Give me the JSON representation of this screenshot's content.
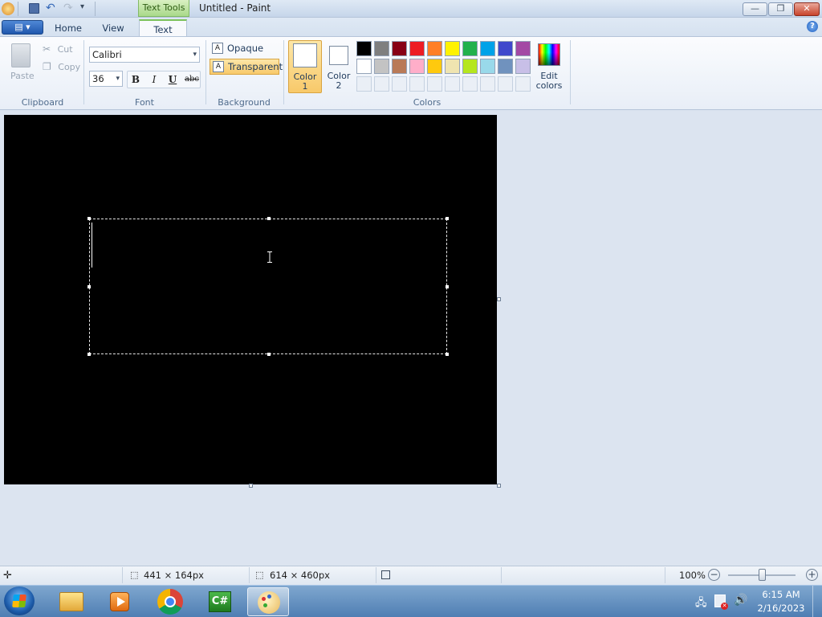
{
  "window": {
    "title": "Untitled - Paint",
    "context_tab": "Text Tools",
    "minimize": "—",
    "restore": "❐",
    "close": "✕"
  },
  "tabs": [
    {
      "label": "Home",
      "active": false
    },
    {
      "label": "View",
      "active": false
    },
    {
      "label": "Text",
      "active": true
    }
  ],
  "app_menu_label": "▤ ▾",
  "help": "?",
  "clipboard": {
    "group": "Clipboard",
    "paste": "Paste",
    "cut": "Cut",
    "copy": "Copy"
  },
  "font": {
    "group": "Font",
    "family": "Calibri",
    "size": "36",
    "bold": "B",
    "italic": "I",
    "underline": "U",
    "strike": "abc"
  },
  "background": {
    "group": "Background",
    "opaque": "Opaque",
    "transparent": "Transparent",
    "icon": "A"
  },
  "colors": {
    "group": "Colors",
    "color1": "Color 1",
    "color1_line1": "Color",
    "color1_line2": "1",
    "color2_line1": "Color",
    "color2_line2": "2",
    "edit_line1": "Edit",
    "edit_line2": "colors",
    "color1_value": "#ffffff",
    "color2_value": "#ffffff",
    "palette_row1": [
      "#000000",
      "#7f7f7f",
      "#880015",
      "#ed1c24",
      "#ff7f27",
      "#fff200",
      "#22b14c",
      "#00a2e8",
      "#3f48cc",
      "#a349a4"
    ],
    "palette_row2": [
      "#ffffff",
      "#c3c3c3",
      "#b97a57",
      "#ffaec9",
      "#ffc90e",
      "#efe4b0",
      "#b5e61d",
      "#99d9ea",
      "#7092be",
      "#c8bfe7"
    ]
  },
  "canvas_background": "#000000",
  "status": {
    "selection_size": "441 × 164px",
    "canvas_size": "614 × 460px",
    "zoom": "100%",
    "minus": "−",
    "plus": "+"
  },
  "taskbar": {
    "time": "6:15 AM",
    "date": "2/16/2023",
    "apps": [
      "start-orb",
      "file-explorer",
      "media-player",
      "chrome",
      "csharp-app",
      "paint"
    ]
  }
}
